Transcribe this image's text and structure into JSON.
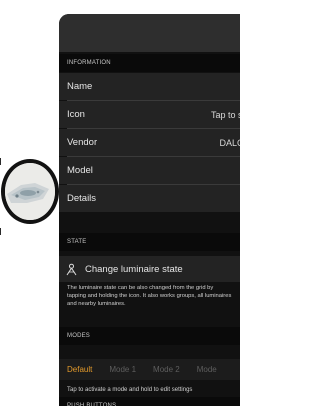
{
  "information": {
    "header": "INFORMATION",
    "rows": [
      {
        "label": "Name",
        "value": ""
      },
      {
        "label": "Icon",
        "value": "Tap to set"
      },
      {
        "label": "Vendor",
        "value": "DALCN"
      },
      {
        "label": "Model",
        "value": ""
      },
      {
        "label": "Details",
        "value": ""
      }
    ]
  },
  "state": {
    "header": "STATE",
    "change_label": "Change luminaire state",
    "icon": "luminaire-icon",
    "note": "The luminaire state can be also changed from the grid by tapping and holding the icon. It also works groups, all luminaires and nearby luminaires."
  },
  "modes": {
    "header": "MODES",
    "items": [
      "Default",
      "Mode 1",
      "Mode 2",
      "Mode"
    ],
    "selected": "Default",
    "hint": "Tap to activate a mode and hold to edit settings"
  },
  "push_buttons": {
    "header": "PUSH BUTTONS"
  },
  "colors": {
    "accent": "#e39a2b",
    "panel_bg": "#111111",
    "row_bg": "#232323"
  }
}
